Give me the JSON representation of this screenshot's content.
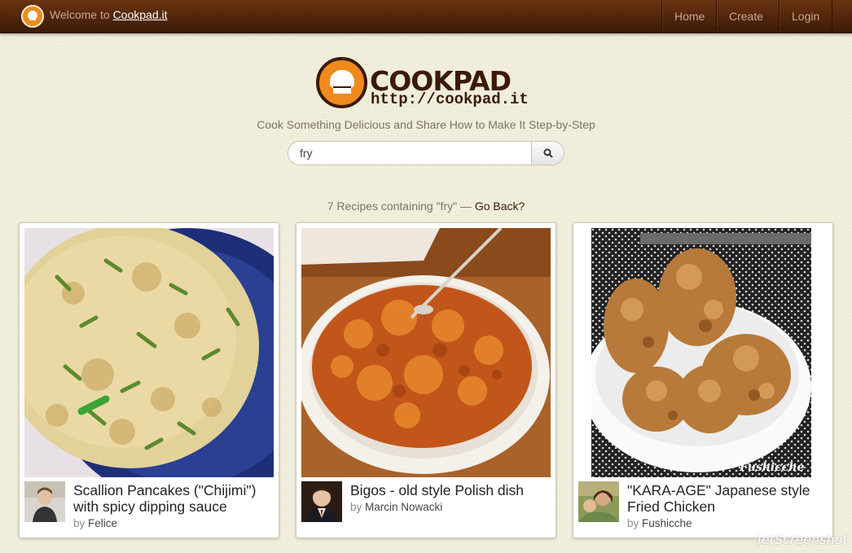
{
  "topbar": {
    "welcome_prefix": "Welcome to",
    "welcome_link": "Cookpad.it",
    "nav": [
      "Home",
      "Create",
      "Login"
    ]
  },
  "header": {
    "brand": "COOKPAD",
    "brand_url": "http://cookpad.it",
    "tagline": "Cook Something Delicious and Share How to Make It Step-by-Step"
  },
  "search": {
    "value": "fry",
    "button_icon": "search-icon"
  },
  "results": {
    "summary": "7 Recipes containing \"fry\" —",
    "back_link": "Go Back?"
  },
  "recipes": [
    {
      "title": "Scallion Pancakes (\"Chijimi\") with spicy dipping sauce",
      "by_label": "by",
      "author": "Felice"
    },
    {
      "title": "Bigos - old style Polish dish",
      "by_label": "by",
      "author": "Marcin Nowacki"
    },
    {
      "title": "\"KARA-AGE\" Japanese style Fried Chicken",
      "by_label": "by",
      "author": "Fushicche"
    }
  ],
  "photo_caption_3": "Fushicche",
  "watermark": "JetScreenshot",
  "colors": {
    "brand_brown": "#3b1a06",
    "brand_orange": "#f08a1c",
    "background": "#efecd9"
  }
}
